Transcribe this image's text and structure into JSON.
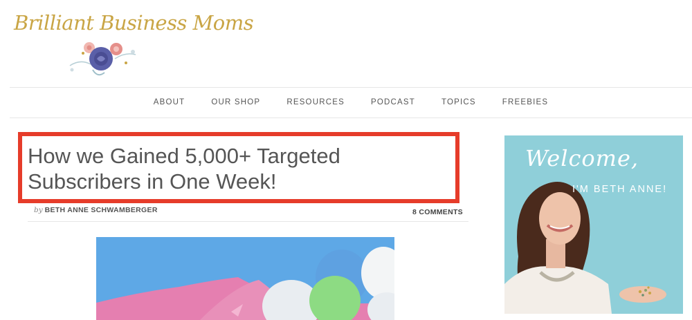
{
  "site": {
    "logo_text": "Brilliant Business Moms"
  },
  "nav": {
    "items": [
      "ABOUT",
      "OUR SHOP",
      "RESOURCES",
      "PODCAST",
      "TOPICS",
      "FREEBIES"
    ]
  },
  "post": {
    "title": "How we Gained 5,000+ Targeted Subscribers in One Week!",
    "by_prefix": "by",
    "author": "BETH ANNE SCHWAMBERGER",
    "comments": "8 COMMENTS"
  },
  "sidebar": {
    "welcome": "Welcome,",
    "intro": "I'M BETH ANNE!"
  },
  "colors": {
    "highlight_border": "#e63c2a",
    "logo_gold": "#c9a545",
    "sidebar_bg": "#8fcfd9"
  }
}
